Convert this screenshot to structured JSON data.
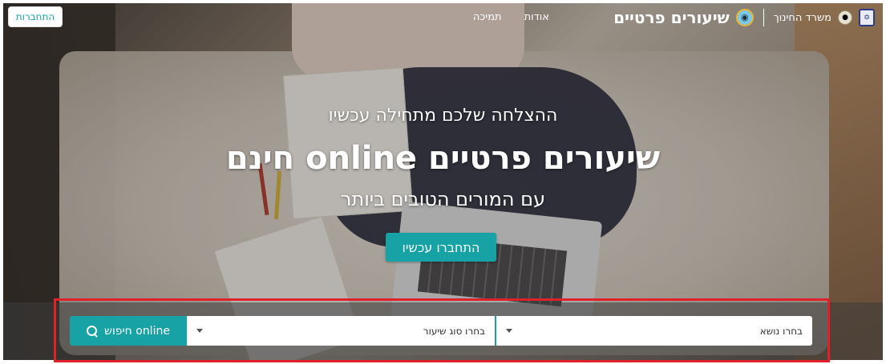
{
  "nav": {
    "emblem_icon": "state-emblem-icon",
    "ministry_label": "משרד החינוך",
    "brand_icon": "owl-icon",
    "brand_title": "שיעורים פרטיים",
    "links": [
      "אודות",
      "תמיכה"
    ],
    "login_label": "התחברות"
  },
  "hero": {
    "tagline": "ההצלחה שלכם מתחילה עכשיו",
    "headline": "שיעורים פרטיים online חינם",
    "subline": "עם המורים הטובים ביותר",
    "cta_label": "התחברו עכשיו"
  },
  "search": {
    "subject_placeholder": "בחרו נושא",
    "lesson_type_placeholder": "בחרו סוג שיעור",
    "button_label": "חיפוש online",
    "button_icon": "search-icon"
  },
  "colors": {
    "accent": "#17a2a5",
    "highlight": "#e0202a"
  }
}
